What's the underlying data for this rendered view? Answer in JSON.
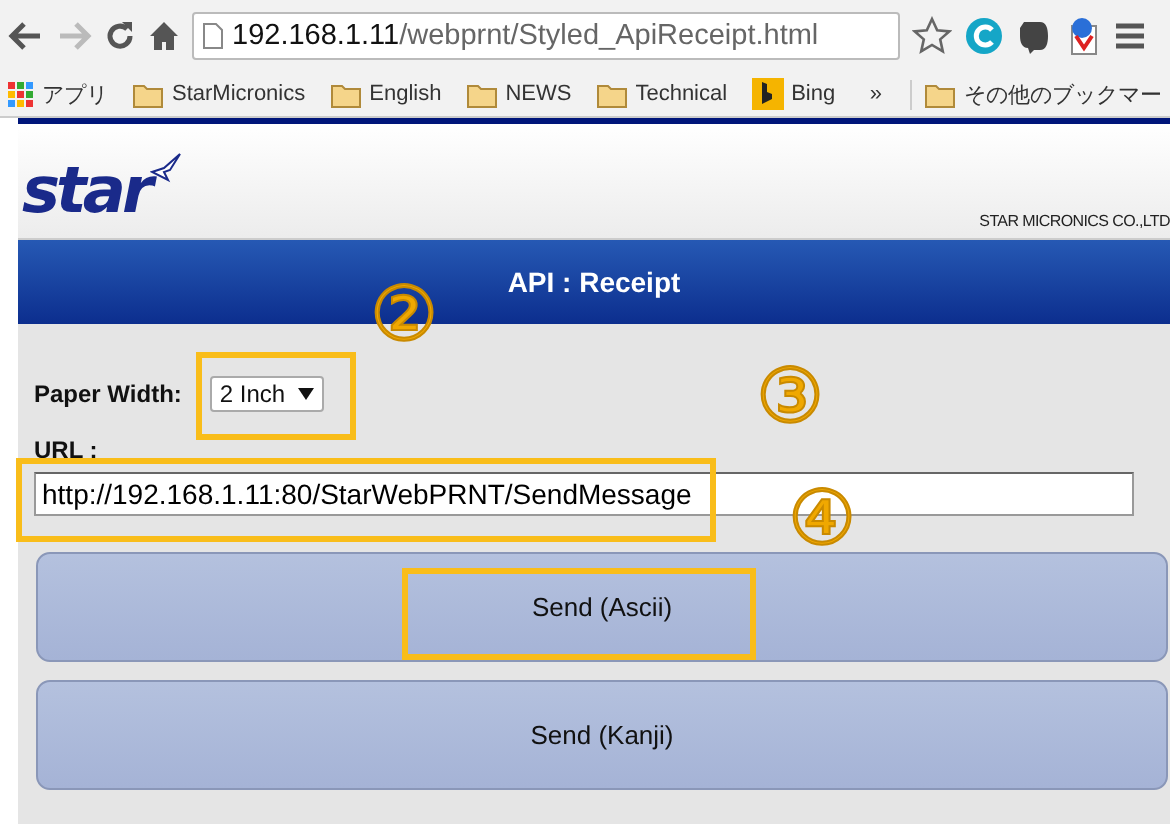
{
  "browser": {
    "address": {
      "host": "192.168.1.11",
      "path": "/webprnt/Styled_ApiReceipt.html"
    },
    "bookmarks": [
      {
        "kind": "apps",
        "label": "アプリ"
      },
      {
        "kind": "folder",
        "label": "StarMicronics"
      },
      {
        "kind": "folder",
        "label": "English"
      },
      {
        "kind": "folder",
        "label": "NEWS"
      },
      {
        "kind": "folder",
        "label": "Technical"
      },
      {
        "kind": "bing",
        "label": "Bing"
      }
    ],
    "overflow": "»",
    "other_bookmarks": "その他のブックマー"
  },
  "header": {
    "logo": "star",
    "company": "STAR MICRONICS CO.,LTD"
  },
  "banner": {
    "title": "API : Receipt"
  },
  "form": {
    "paper_width_label": "Paper Width:",
    "paper_width": "2 Inch",
    "url_label": "URL :",
    "url": "http://192.168.1.11:80/StarWebPRNT/SendMessage"
  },
  "buttons": [
    "Send (Ascii)",
    "Send (Kanji)"
  ],
  "annotations": [
    {
      "kind": "number",
      "text": "②"
    },
    {
      "kind": "box"
    },
    {
      "kind": "number",
      "text": "③"
    },
    {
      "kind": "box"
    },
    {
      "kind": "number",
      "text": "④"
    },
    {
      "kind": "box"
    }
  ]
}
